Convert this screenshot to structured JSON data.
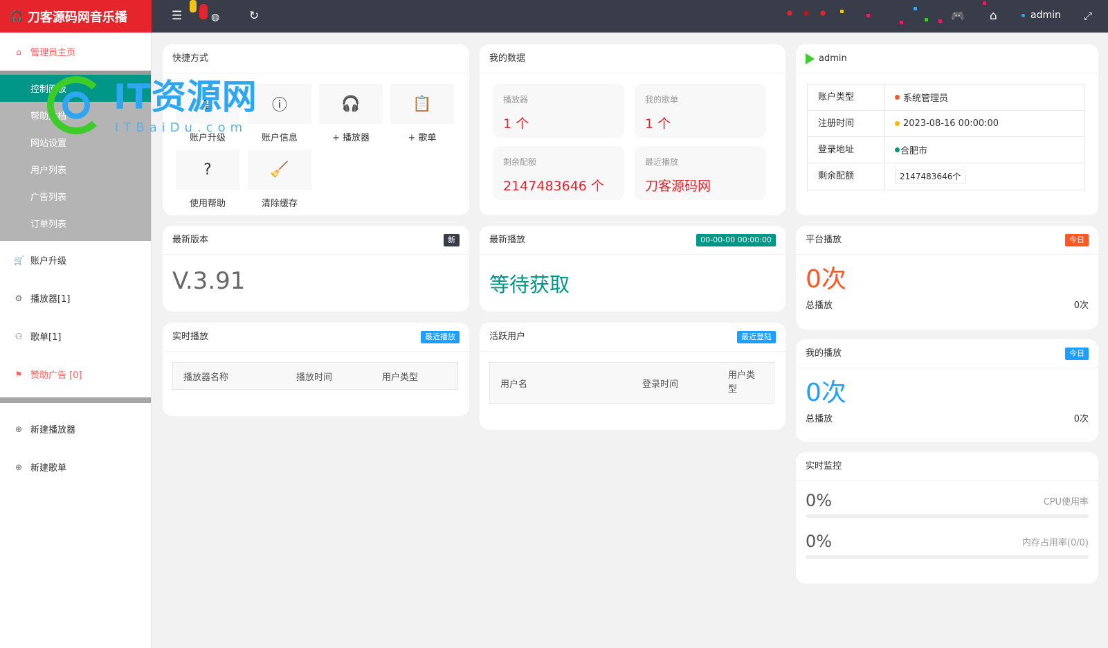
{
  "header": {
    "app_title": "刀客源码网音乐播",
    "username": "admin"
  },
  "watermark": {
    "text": "IT资源网",
    "subtext": "ITBaiDu.com"
  },
  "sidebar": {
    "home": "管理员主页",
    "submenu": [
      "控制面板",
      "帮助文档",
      "网站设置",
      "用户列表",
      "广告列表",
      "订单列表"
    ],
    "items": [
      {
        "label": "账户升级",
        "icon": "cart-icon"
      },
      {
        "label": "播放器[1]",
        "icon": "gear-icon"
      },
      {
        "label": "歌单[1]",
        "icon": "user-icon"
      },
      {
        "label": "赞助广告 [0]",
        "icon": "flag-icon"
      }
    ],
    "create": [
      {
        "label": "新建播放器",
        "icon": "plus-circle-icon"
      },
      {
        "label": "新建歌单",
        "icon": "plus-circle-icon"
      }
    ]
  },
  "shortcuts": {
    "title": "快捷方式",
    "items": [
      {
        "label": "账户升级",
        "icon": "upgrade-icon"
      },
      {
        "label": "账户信息",
        "icon": "info-icon"
      },
      {
        "label": "+ 播放器",
        "icon": "headphones-icon"
      },
      {
        "label": "+ 歌单",
        "icon": "clipboard-icon"
      },
      {
        "label": "使用帮助",
        "icon": "help-doc-icon"
      },
      {
        "label": "清除缓存",
        "icon": "broom-icon"
      }
    ]
  },
  "mydata": {
    "title": "我的数据",
    "tiles": [
      {
        "label": "播放器",
        "value": "1 个"
      },
      {
        "label": "我的歌单",
        "value": "1 个"
      },
      {
        "label": "剩余配额",
        "value": "2147483646 个"
      },
      {
        "label": "最近播放",
        "value": "刀客源码网"
      }
    ]
  },
  "account": {
    "title": "admin",
    "rows": [
      {
        "key": "账户类型",
        "value": "系统管理员",
        "dot": "#ff5722"
      },
      {
        "key": "注册时间",
        "value": "2023-08-16 00:00:00",
        "dot": "#ffb800"
      },
      {
        "key": "登录地址",
        "value": "合肥市",
        "dot": "#009688"
      },
      {
        "key": "剩余配额",
        "value": "2147483646个"
      }
    ]
  },
  "version": {
    "title": "最新版本",
    "badge": "新",
    "value": "V.3.91"
  },
  "latest_play": {
    "title": "最新播放",
    "badge": "00-00-00 00:00:00",
    "value": "等待获取"
  },
  "realtime_play": {
    "title": "实时播放",
    "badge": "最近播放",
    "columns": [
      "播放器名称",
      "播放时间",
      "用户类型"
    ]
  },
  "active_users": {
    "title": "活跃用户",
    "badge": "最近登陆",
    "columns": [
      "用户名",
      "登录时间",
      "用户类型"
    ]
  },
  "platform_play": {
    "title": "平台播放",
    "badge": "今日",
    "value": "0次",
    "total_label": "总播放",
    "total_value": "0次"
  },
  "my_play": {
    "title": "我的播放",
    "badge": "今日",
    "value": "0次",
    "total_label": "总播放",
    "total_value": "0次"
  },
  "monitor": {
    "title": "实时监控",
    "cpu_value": "0%",
    "cpu_label": "CPU使用率",
    "cpu_fraction": 0,
    "mem_value": "0%",
    "mem_label": "内存占用率(0/0)",
    "mem_fraction": 0
  },
  "colors": {
    "brand_red": "#e5252b",
    "teal": "#009688",
    "orange": "#ff5722",
    "blue": "#1e9fff",
    "dark": "#393d49"
  }
}
